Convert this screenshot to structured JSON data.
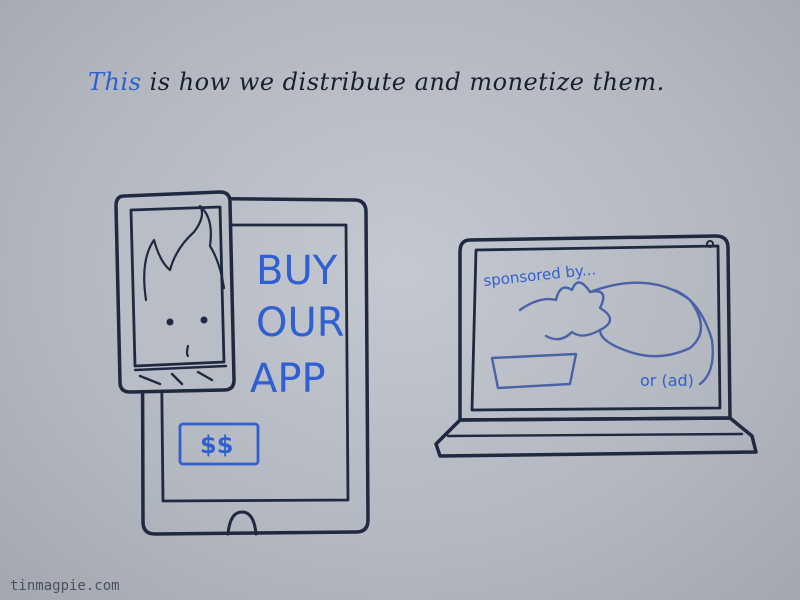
{
  "caption": {
    "highlight": "This",
    "rest": " is how we distribute and monetize them."
  },
  "tablet": {
    "ad_lines": [
      "BUY",
      "OUR",
      "APP"
    ],
    "price_label": "$$"
  },
  "laptop": {
    "sponsor_text": "sponsored by...",
    "ad_text": "or (ad)"
  },
  "watermark": "tinmagpie.com",
  "colors": {
    "background": "#b8bcc4",
    "ink": "#1f2940",
    "accent_blue": "#2f5fd0",
    "sketch_blue": "#4c62a8"
  }
}
